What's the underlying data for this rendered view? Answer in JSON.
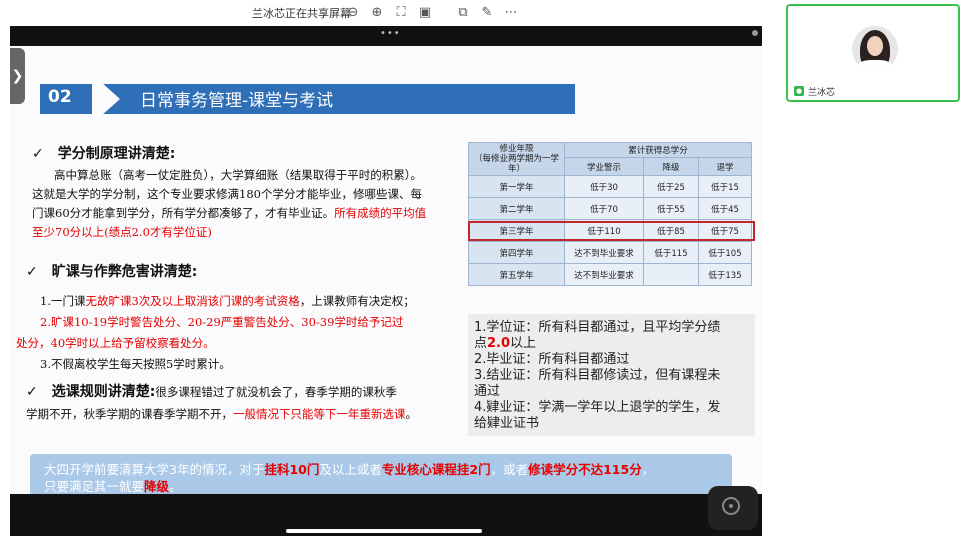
{
  "toolbar": {
    "share_status": "兰冰芯正在共享屏幕",
    "icons": [
      "zoom-out-icon",
      "zoom-in-icon",
      "fit-screen-icon",
      "actual-size-icon",
      "popout-icon",
      "annotate-icon",
      "more-icon"
    ]
  },
  "slide": {
    "section_number": "02",
    "title": "日常事务管理-课堂与考试",
    "heading1": "学分制原理讲清楚:",
    "para1_lines": [
      "高中算总账（高考一仗定胜负），大学算细账（结果取得于平时的积累）。",
      "这就是大学的学分制，这个专业要求修满180个学分才能毕业，修哪些课、每",
      "门课60分才能拿到学分，所有学分都凑够了，才有毕业证。"
    ],
    "para1_red_tail": "所有成绩的平均值",
    "para1_red_line": "至少70分以上(绩点2.0才有学位证)",
    "heading2": "旷课与作弊危害讲清楚:",
    "rule1_a": "1.一门课",
    "rule1_red": "无故旷课3次及以上取消该门课的考试资格",
    "rule1_b": "，上课教师有决定权；",
    "rule2_line1": "2.旷课10-19学时警告处分、20-29严重警告处分、30-39学时给予记过",
    "rule2_line2": "处分，40学时以上给予留校察看处分。",
    "rule3": "3.不假离校学生每天按照5学时累计。",
    "heading3": "选课规则讲清楚:",
    "para3_a": "很多课程错过了就没机会了，春季学期的课秋季",
    "para3_b": "学期不开，秋季学期的课春季学期不开，",
    "para3_red": "一般情况下只能等下一年重新选课",
    "para3_end": "。",
    "table": {
      "col_year": "修业年限\n（每修业两学期为一学年）",
      "col_group": "累计获得总学分",
      "headers": [
        "学业警示",
        "降级",
        "退学"
      ],
      "rows": [
        {
          "year": "第一学年",
          "warn": "低于30",
          "demote": "低于25",
          "drop": "低于15"
        },
        {
          "year": "第二学年",
          "warn": "低于70",
          "demote": "低于55",
          "drop": "低于45"
        },
        {
          "year": "第三学年",
          "warn": "低于110",
          "demote": "低于85",
          "drop": "低于75"
        },
        {
          "year": "第四学年",
          "warn": "达不到毕业要求",
          "demote": "低于115",
          "drop": "低于105"
        },
        {
          "year": "第五学年",
          "warn": "达不到毕业要求",
          "demote": "",
          "drop": "低于135"
        }
      ]
    },
    "certs": {
      "c1_a": "1.学位证：所有科目都通过，且平均学分绩",
      "c1_b": "点",
      "c1_red": "2.0",
      "c1_c": "以上",
      "c2": "2.毕业证：所有科目都通过",
      "c3_a": "3.结业证：所有科目都修读过，但有课程未",
      "c3_b": "通过",
      "c4_a": "4.肄业证：学满一学年以上退学的学生，发",
      "c4_b": "给肄业证书"
    },
    "bottom": {
      "t1": "大四开学前要清算大学3年的情况，对于",
      "h1": "挂科10门",
      "t2": "及以上或者",
      "h2": "专业核心课程挂2门",
      "t3": "，或者",
      "h3": "修读学分不达115分",
      "t4": "，",
      "t5": "只要满足其一就要",
      "h4": "降级",
      "t6": "。"
    }
  },
  "participant": {
    "name": "兰冰芯"
  }
}
